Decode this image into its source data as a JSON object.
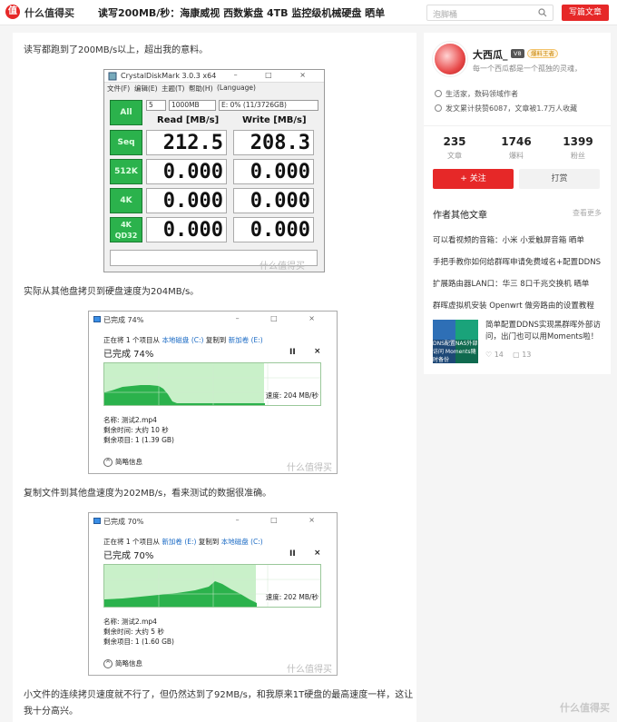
{
  "header": {
    "logo_glyph": "值",
    "site_name": "什么值得买",
    "article_title": "读写200MB/秒：海康威视 西数紫盘 4TB 监控级机械硬盘 晒单",
    "search_placeholder": "泡脚桶",
    "write_button": "写篇文章"
  },
  "article": {
    "para1": "读写都跑到了200MB/s以上，超出我的意料。",
    "para2": "实际从其他盘拷贝到硬盘速度为204MB/s。",
    "para3": "复制文件到其他盘速度为202MB/s，看来测试的数据很准确。",
    "para4a": "小文件的连续拷贝速度就不行了，但仍然达到了92MB/s，和我原来1T硬盘的最高速度一样，这让",
    "para4b": "我十分高兴。",
    "watermark": "什么值得买"
  },
  "cdm": {
    "title": "CrystalDiskMark 3.0.3 x64",
    "window_controls": "– □ ×",
    "menu": [
      "文件(F)",
      "编辑(E)",
      "主题(T)",
      "帮助(H)",
      "(Language)"
    ],
    "count": "5",
    "size": "1000MB",
    "drive": "E: 0% (11/3726GB)",
    "read_header": "Read [MB/s]",
    "write_header": "Write [MB/s]",
    "all_button": "All",
    "rows": [
      {
        "label": "Seq",
        "read": "212.5",
        "write": "208.3"
      },
      {
        "label": "512K",
        "read": "0.000",
        "write": "0.000"
      },
      {
        "label": "4K",
        "read": "0.000",
        "write": "0.000"
      },
      {
        "label": "4K QD32",
        "read": "0.000",
        "write": "0.000"
      }
    ]
  },
  "copy1": {
    "title": "已完成 74%",
    "window_controls": "– □ ×",
    "line_pre": "正在将 1 个项目从",
    "src": "本地磁盘 (C:)",
    "line_mid": "复制到",
    "dst": "新加卷 (E:)",
    "percent": "已完成 74%",
    "progress": 0.74,
    "speed": "速度: 204 MB/秒",
    "name": "名称: 测试2.mp4",
    "time": "剩余时间: 大约 10 秒",
    "items": "剩余项目: 1 (1.39 GB)",
    "more": "简略信息",
    "pause": "II",
    "close": "×"
  },
  "copy2": {
    "title": "已完成 70%",
    "window_controls": "– □ ×",
    "line_pre": "正在将 1 个项目从",
    "src": "新加卷 (E:)",
    "line_mid": "复制到",
    "dst": "本地磁盘 (C:)",
    "percent": "已完成 70%",
    "progress": 0.7,
    "speed": "速度: 202 MB/秒",
    "name": "名称: 测试2.mp4",
    "time": "剩余时间: 大约 5 秒",
    "items": "剩余项目: 1 (1.60 GB)",
    "more": "简略信息",
    "pause": "II",
    "close": "×"
  },
  "sidebar": {
    "username": "大西瓜_",
    "level": "V8",
    "medal": "爆料王者",
    "bio": "每一个西瓜都是一个孤独的灵魂，",
    "meta1": "生活家，数码领域作者",
    "meta2": "发文累计获赞6087，文章被1.7万人收藏",
    "stats": [
      {
        "num": "235",
        "label": "文章"
      },
      {
        "num": "1746",
        "label": "爆料"
      },
      {
        "num": "1399",
        "label": "粉丝"
      }
    ],
    "follow": "+ 关注",
    "tip": "打赏",
    "other_head": "作者其他文章",
    "other_more": "查看更多",
    "links": [
      "可以看视频的音箱：小米 小爱触屏音箱 晒单",
      "手把手教你如何给群晖申请免费域名+配置DDNS",
      "扩展路由器LAN口：华三 8口千兆交换机 晒单",
      "群晖虚拟机安装 Openwrt 做旁路由的设置教程"
    ],
    "featured_thumb": "DNS配置NAS外部访问 Moments随时备份",
    "featured_title": "简单配置DDNS实现黑群晖外部访问，出门也可以用Moments啦！~",
    "featured_likes": "14",
    "featured_comments": "13"
  },
  "colors": {
    "brand_red": "#e62828",
    "copy_green": "#2bb24c"
  }
}
